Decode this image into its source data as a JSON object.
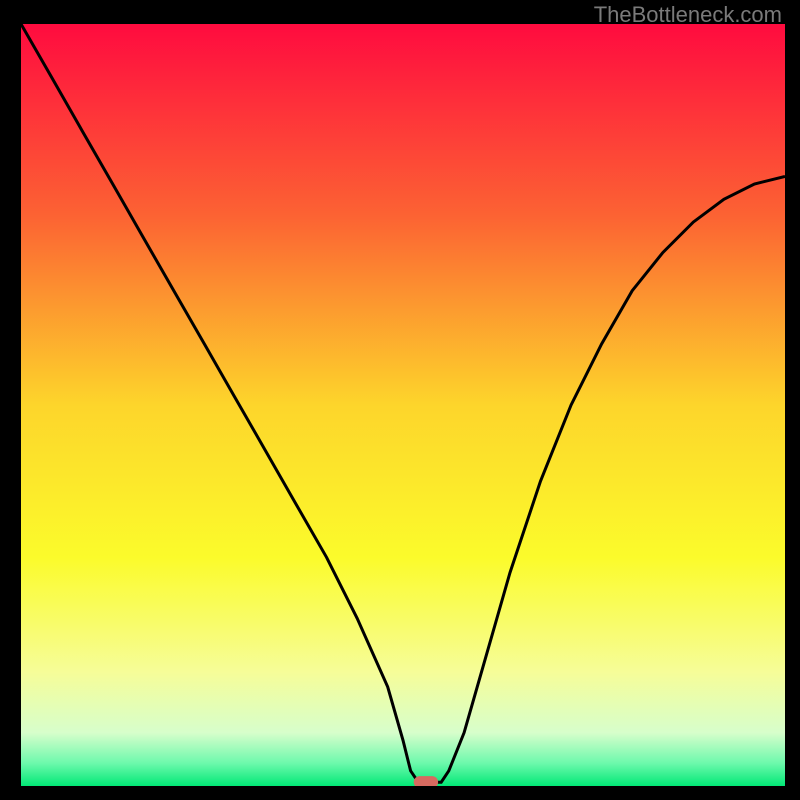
{
  "attribution": "TheBottleneck.com",
  "chart_data": {
    "type": "line",
    "title": "",
    "xlabel": "",
    "ylabel": "",
    "xlim": [
      0,
      100
    ],
    "ylim": [
      0,
      100
    ],
    "background_gradient": {
      "stops": [
        {
          "offset": 0,
          "color": "#ff0b3f"
        },
        {
          "offset": 25,
          "color": "#fc6233"
        },
        {
          "offset": 50,
          "color": "#fdd52b"
        },
        {
          "offset": 70,
          "color": "#fbfb2b"
        },
        {
          "offset": 85,
          "color": "#f6fd98"
        },
        {
          "offset": 93,
          "color": "#d7fecb"
        },
        {
          "offset": 97,
          "color": "#6df9ac"
        },
        {
          "offset": 100,
          "color": "#02e876"
        }
      ]
    },
    "series": [
      {
        "name": "bottleneck-curve",
        "color": "#000000",
        "x": [
          0,
          4,
          8,
          12,
          16,
          20,
          24,
          28,
          32,
          36,
          40,
          44,
          48,
          50,
          51,
          52,
          53,
          55,
          56,
          58,
          60,
          62,
          64,
          68,
          72,
          76,
          80,
          84,
          88,
          92,
          96,
          100
        ],
        "y": [
          100,
          93,
          86,
          79,
          72,
          65,
          58,
          51,
          44,
          37,
          30,
          22,
          13,
          6,
          2,
          0.5,
          0.5,
          0.5,
          2,
          7,
          14,
          21,
          28,
          40,
          50,
          58,
          65,
          70,
          74,
          77,
          79,
          80
        ]
      }
    ],
    "marker": {
      "x": 53,
      "y": 0.5,
      "width_pct": 3.2,
      "height_pct": 1.6,
      "color": "#d66a60"
    }
  }
}
